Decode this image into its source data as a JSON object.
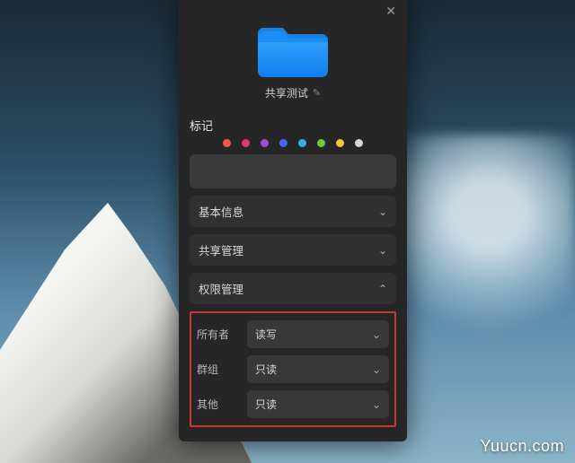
{
  "folder": {
    "name": "共享测试"
  },
  "tags": {
    "label": "标记",
    "colors": [
      "#f25b3a",
      "#e0356f",
      "#9a4fd8",
      "#3e6af2",
      "#2fb4e0",
      "#6fcb3a",
      "#f2c83a",
      "#d8d8d8"
    ]
  },
  "accordions": {
    "basic": "基本信息",
    "share": "共享管理",
    "perm": "权限管理"
  },
  "permissions": {
    "rows": [
      {
        "label": "所有者",
        "value": "读写"
      },
      {
        "label": "群组",
        "value": "只读"
      },
      {
        "label": "其他",
        "value": "只读"
      }
    ]
  },
  "watermark": "Yuucn.com"
}
